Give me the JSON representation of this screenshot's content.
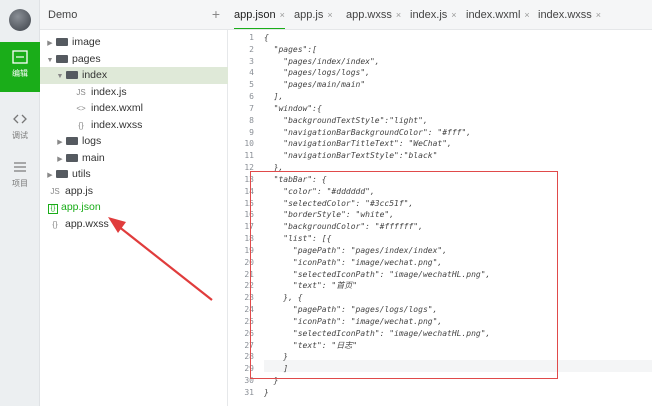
{
  "explorer": {
    "title": "Demo",
    "add_label": "+",
    "items": [
      {
        "label": "image",
        "kind": "folder",
        "caret": "▶",
        "indent": 0
      },
      {
        "label": "pages",
        "kind": "folder",
        "caret": "▼",
        "indent": 0
      },
      {
        "label": "index",
        "kind": "folder",
        "caret": "▼",
        "indent": 1
      },
      {
        "label": "index.js",
        "kind": "file",
        "icon": "JS",
        "indent": 2
      },
      {
        "label": "index.wxml",
        "kind": "file",
        "icon": "<>",
        "indent": 2
      },
      {
        "label": "index.wxss",
        "kind": "file",
        "icon": "{}",
        "indent": 2
      },
      {
        "label": "logs",
        "kind": "folder",
        "caret": "▶",
        "indent": 1
      },
      {
        "label": "main",
        "kind": "folder",
        "caret": "▶",
        "indent": 1
      },
      {
        "label": "utils",
        "kind": "folder",
        "caret": "▶",
        "indent": 0
      },
      {
        "label": "app.js",
        "kind": "file",
        "icon": "JS",
        "indent": 0
      },
      {
        "label": "app.json",
        "kind": "file",
        "icon": "{}",
        "indent": 0
      },
      {
        "label": "app.wxss",
        "kind": "file",
        "icon": "{}",
        "indent": 0
      }
    ]
  },
  "activity": {
    "items": [
      {
        "label": "编辑",
        "icon": "editor-icon"
      },
      {
        "label": "调试",
        "icon": "debug-icon"
      },
      {
        "label": "项目",
        "icon": "project-icon"
      }
    ]
  },
  "tabs": [
    {
      "label": "app.json",
      "close": "×"
    },
    {
      "label": "app.js",
      "close": "×"
    },
    {
      "label": "app.wxss",
      "close": "×"
    },
    {
      "label": "index.js",
      "close": "×"
    },
    {
      "label": "index.wxml",
      "close": "×"
    },
    {
      "label": "index.wxss",
      "close": "×"
    }
  ],
  "editor": {
    "lines": [
      "{",
      "  \"pages\":[",
      "    \"pages/index/index\",",
      "    \"pages/logs/logs\",",
      "    \"pages/main/main\"",
      "  ],",
      "  \"window\":{",
      "    \"backgroundTextStyle\":\"light\",",
      "    \"navigationBarBackgroundColor\": \"#fff\",",
      "    \"navigationBarTitleText\": \"WeChat\",",
      "    \"navigationBarTextStyle\":\"black\"",
      "  },",
      "  \"tabBar\": {",
      "    \"color\": \"#dddddd\",",
      "    \"selectedColor\": \"#3cc51f\",",
      "    \"borderStyle\": \"white\",",
      "    \"backgroundColor\": \"#ffffff\",",
      "    \"list\": [{",
      "      \"pagePath\": \"pages/index/index\",",
      "      \"iconPath\": \"image/wechat.png\",",
      "      \"selectedIconPath\": \"image/wechatHL.png\",",
      "      \"text\": \"首页\"",
      "    }, {",
      "      \"pagePath\": \"pages/logs/logs\",",
      "      \"iconPath\": \"image/wechat.png\",",
      "      \"selectedIconPath\": \"image/wechatHL.png\",",
      "      \"text\": \"日志\"",
      "    }",
      "    ]",
      "  }",
      "}",
      ""
    ],
    "line_numbers": [
      "1",
      "2",
      "3",
      "4",
      "5",
      "6",
      "7",
      "8",
      "9",
      "10",
      "11",
      "12",
      "13",
      "14",
      "15",
      "16",
      "17",
      "18",
      "19",
      "20",
      "21",
      "22",
      "23",
      "24",
      "25",
      "26",
      "27",
      "28",
      "29",
      "30",
      "31"
    ]
  },
  "colors": {
    "accent": "#1aad19",
    "highlight_box": "#e04a4a",
    "arrow": "#e03c3c"
  }
}
